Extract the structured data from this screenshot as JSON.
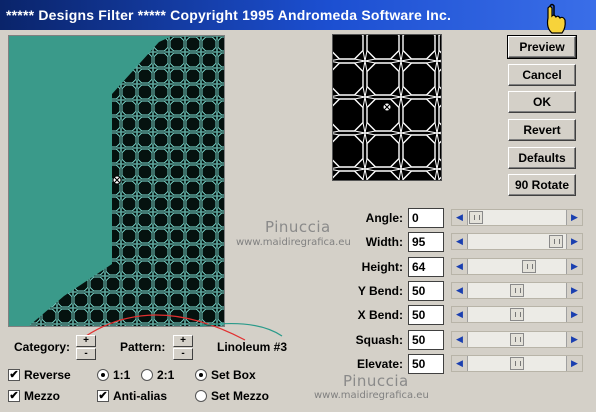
{
  "window": {
    "title": "***** Designs Filter *****  Copyright 1995 Andromeda Software Inc."
  },
  "buttons": {
    "preview": "Preview",
    "cancel": "Cancel",
    "ok": "OK",
    "revert": "Revert",
    "defaults": "Defaults",
    "rotate": "90 Rotate"
  },
  "params": [
    {
      "label": "Angle:",
      "value": "0",
      "level": 0.02
    },
    {
      "label": "Width:",
      "value": "95",
      "level": 0.95
    },
    {
      "label": "Height:",
      "value": "64",
      "level": 0.64
    },
    {
      "label": "Y Bend:",
      "value": "50",
      "level": 0.5
    },
    {
      "label": "X Bend:",
      "value": "50",
      "level": 0.5
    },
    {
      "label": "Squash:",
      "value": "50",
      "level": 0.5
    },
    {
      "label": "Elevate:",
      "value": "50",
      "level": 0.5
    }
  ],
  "selectors": {
    "category_label": "Category:",
    "pattern_label": "Pattern:",
    "pattern_name": "Linoleum #3",
    "plus": "+",
    "minus": "-"
  },
  "options": {
    "reverse": {
      "label": "Reverse",
      "checked": true
    },
    "mezzo": {
      "label": "Mezzo",
      "checked": true
    },
    "antialias": {
      "label": "Anti-alias",
      "checked": true
    },
    "ratio_1_1": {
      "label": "1:1",
      "selected": true
    },
    "ratio_2_1": {
      "label": "2:1",
      "selected": false
    },
    "set_box": {
      "label": "Set Box",
      "selected": true
    },
    "set_mezzo": {
      "label": "Set Mezzo",
      "selected": false
    }
  },
  "watermark": {
    "name": "Pinuccia",
    "url": "www.maidiregrafica.eu"
  },
  "colors": {
    "title_bar": "#0a246a",
    "teal_background": "#3a9a8a",
    "pattern_lines": "#7fe0d4"
  }
}
